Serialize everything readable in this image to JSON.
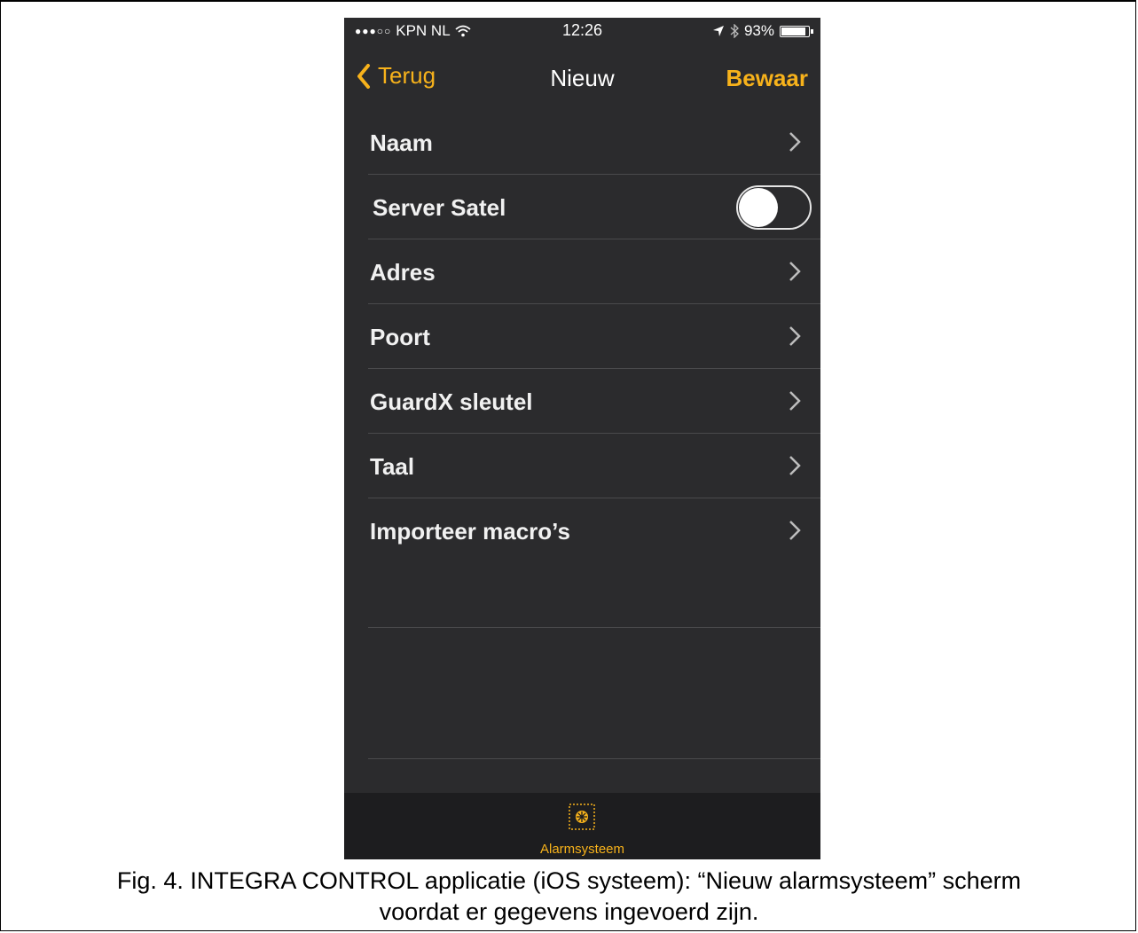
{
  "status_bar": {
    "carrier": "KPN NL",
    "time": "12:26",
    "battery": "93%",
    "battery_level": 0.93
  },
  "nav": {
    "back_label": "Terug",
    "title": "Nieuw",
    "save_label": "Bewaar"
  },
  "settings": {
    "rows": [
      {
        "label": "Naam",
        "type": "disclosure"
      },
      {
        "label": "Server Satel",
        "type": "toggle",
        "value": false
      },
      {
        "label": "Adres",
        "type": "disclosure"
      },
      {
        "label": "Poort",
        "type": "disclosure"
      },
      {
        "label": "GuardX sleutel",
        "type": "disclosure"
      },
      {
        "label": "Taal",
        "type": "disclosure"
      },
      {
        "label": "Importeer macro’s",
        "type": "disclosure"
      }
    ]
  },
  "tabbar": {
    "tabs": [
      {
        "label": "Alarmsysteem",
        "icon": "alarm-system-icon"
      }
    ]
  },
  "caption": {
    "line1": "Fig. 4. INTEGRA CONTROL applicatie (iOS systeem): “Nieuw alarmsysteem” scherm",
    "line2": "voordat er gegevens ingevoerd zijn."
  },
  "colors": {
    "accent": "#f7b21b",
    "background": "#2b2b2d",
    "tabbar": "#1d1d1f"
  }
}
